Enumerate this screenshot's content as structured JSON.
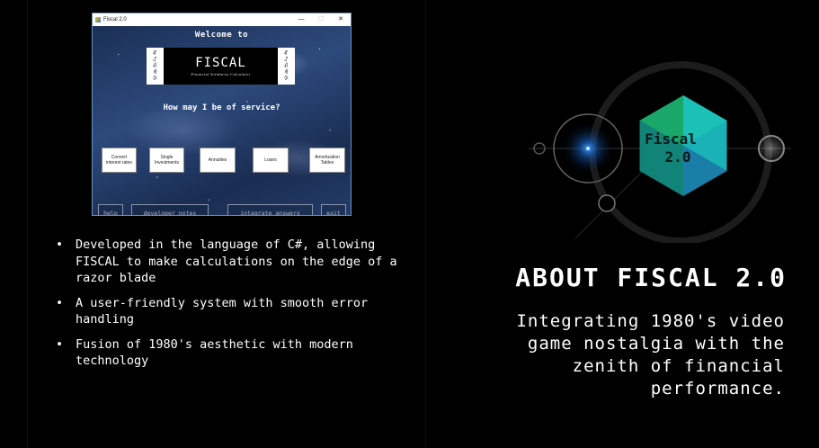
{
  "app_window": {
    "title": "Fiscal 2.0",
    "controls": {
      "minimize": "—",
      "maximize": "☐",
      "close": "✕"
    },
    "welcome": "Welcome to",
    "logo": {
      "name": "FISCAL",
      "tagline": "Financial Solidarity Calculator",
      "side_glyphs": [
        "ꊍ",
        "ꁴ",
        "ꋬ",
        "ꆂ",
        "ꋉ"
      ]
    },
    "prompt": "How may I be of service?",
    "menu_buttons": [
      "Convert interest rates",
      "Single Investments",
      "Annuities",
      "Loans",
      "Amortization Tables"
    ],
    "bottom_buttons": [
      "help",
      "developer notes",
      "integrate answers",
      "exit"
    ]
  },
  "features": {
    "bullet": "•",
    "items": [
      "Developed in the language of C#, allowing FISCAL to make calculations on the edge of a razor blade",
      "A user-friendly system with smooth error handling",
      "Fusion of 1980's aesthetic with modern technology"
    ]
  },
  "emblem": {
    "line1": "Fiscal",
    "line2": "2.0",
    "colors": {
      "hex_green": "#1aa86a",
      "hex_teal": "#1cc4c4",
      "hex_blue": "#1b7ea8",
      "hex_dark": "#0f4a6e"
    }
  },
  "about": {
    "title": "ABOUT FISCAL 2.0",
    "description": "Integrating 1980's video game nostalgia with the zenith of financial performance."
  }
}
